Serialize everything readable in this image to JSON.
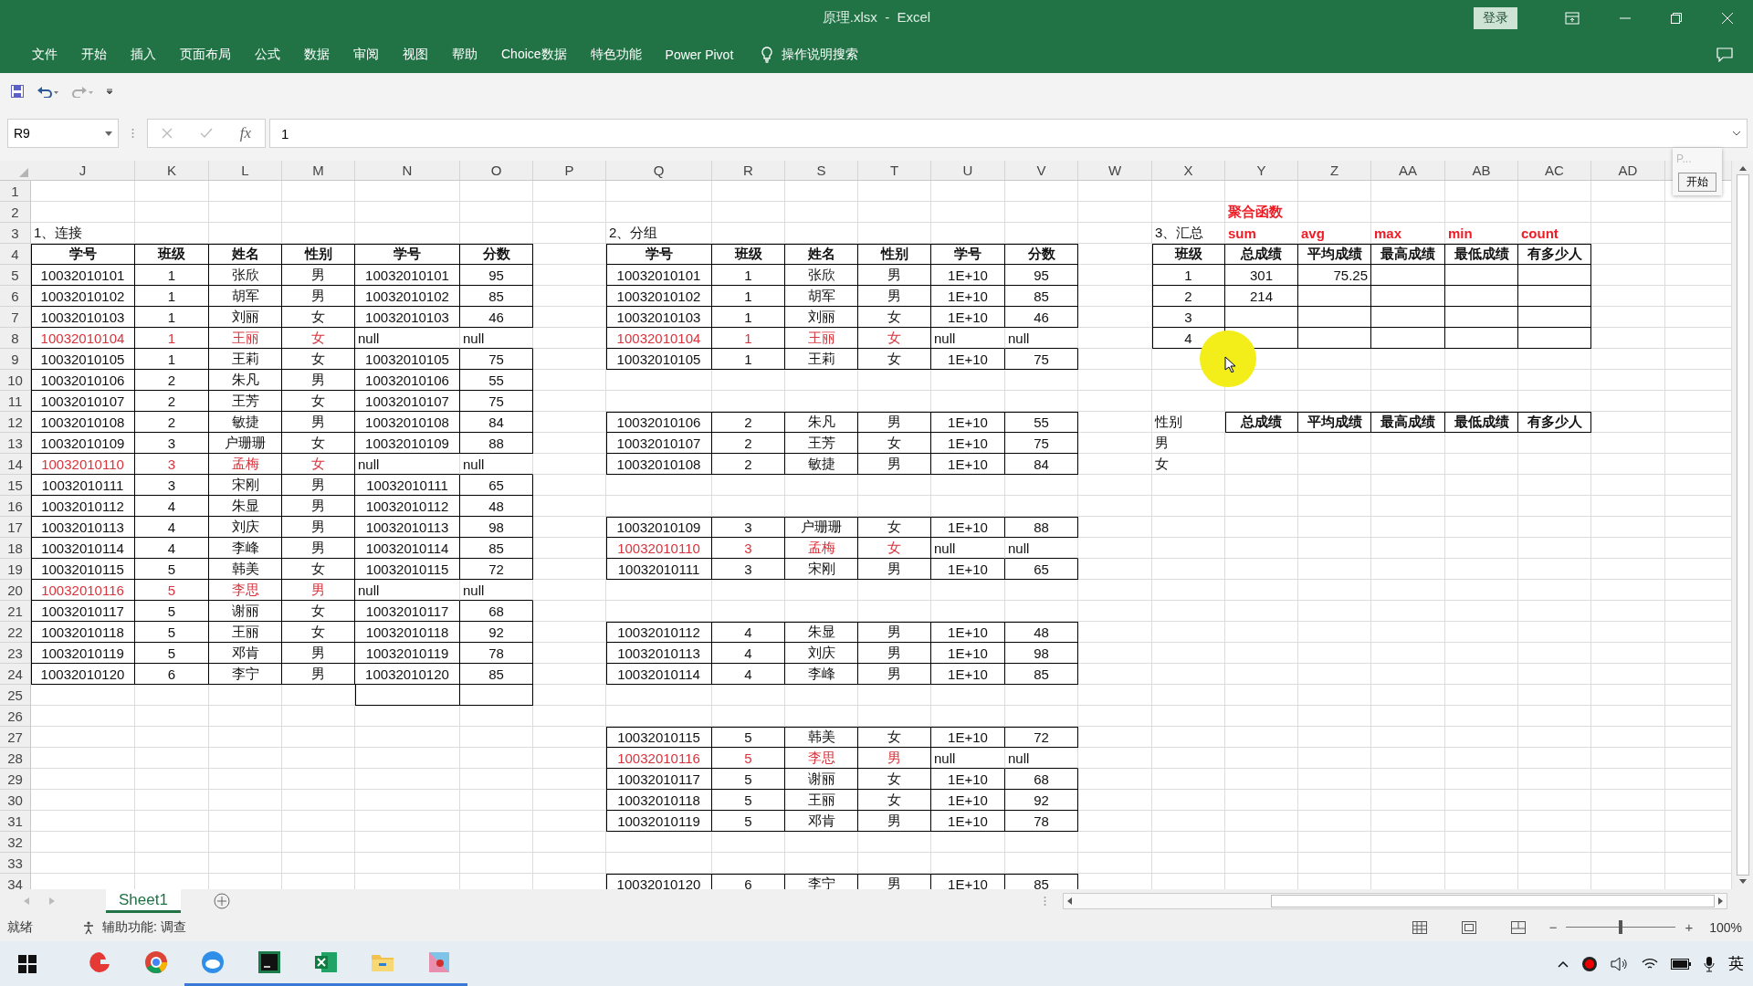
{
  "title_bar": {
    "title": "原理.xlsx  -  Excel",
    "login": "登录"
  },
  "ribbon_tabs": [
    "文件",
    "开始",
    "插入",
    "页面布局",
    "公式",
    "数据",
    "审阅",
    "视图",
    "帮助",
    "Choice数据",
    "特色功能",
    "Power Pivot"
  ],
  "tell_me": "操作说明搜索",
  "formula_bar": {
    "name_box": "R9",
    "fx": "fx",
    "value": "1"
  },
  "columns": [
    "J",
    "K",
    "L",
    "M",
    "N",
    "O",
    "P",
    "Q",
    "R",
    "S",
    "T",
    "U",
    "V",
    "W",
    "X",
    "Y",
    "Z",
    "AA",
    "AB",
    "AC",
    "AD"
  ],
  "rows": [
    "1",
    "2",
    "3",
    "4",
    "5",
    "6",
    "7",
    "8",
    "9",
    "10",
    "11",
    "12",
    "13",
    "14",
    "15",
    "16",
    "17",
    "18",
    "19",
    "20",
    "21",
    "22",
    "23",
    "24",
    "25",
    "26",
    "27",
    "28",
    "29",
    "30",
    "31",
    "32",
    "33",
    "34"
  ],
  "join_table": {
    "title": "1、连接",
    "headers": [
      "学号",
      "班级",
      "姓名",
      "性别",
      "学号",
      "分数"
    ],
    "rows": [
      {
        "cells": [
          "10032010101",
          "1",
          "张欣",
          "男",
          "10032010101",
          "95"
        ],
        "missing": false
      },
      {
        "cells": [
          "10032010102",
          "1",
          "胡军",
          "男",
          "10032010102",
          "85"
        ],
        "missing": false
      },
      {
        "cells": [
          "10032010103",
          "1",
          "刘丽",
          "女",
          "10032010103",
          "46"
        ],
        "missing": false
      },
      {
        "cells": [
          "10032010104",
          "1",
          "王丽",
          "女",
          "null",
          "null"
        ],
        "missing": true
      },
      {
        "cells": [
          "10032010105",
          "1",
          "王莉",
          "女",
          "10032010105",
          "75"
        ],
        "missing": false
      },
      {
        "cells": [
          "10032010106",
          "2",
          "朱凡",
          "男",
          "10032010106",
          "55"
        ],
        "missing": false
      },
      {
        "cells": [
          "10032010107",
          "2",
          "王芳",
          "女",
          "10032010107",
          "75"
        ],
        "missing": false
      },
      {
        "cells": [
          "10032010108",
          "2",
          "敏捷",
          "男",
          "10032010108",
          "84"
        ],
        "missing": false
      },
      {
        "cells": [
          "10032010109",
          "3",
          "户珊珊",
          "女",
          "10032010109",
          "88"
        ],
        "missing": false
      },
      {
        "cells": [
          "10032010110",
          "3",
          "孟梅",
          "女",
          "null",
          "null"
        ],
        "missing": true
      },
      {
        "cells": [
          "10032010111",
          "3",
          "宋刚",
          "男",
          "10032010111",
          "65"
        ],
        "missing": false
      },
      {
        "cells": [
          "10032010112",
          "4",
          "朱显",
          "男",
          "10032010112",
          "48"
        ],
        "missing": false
      },
      {
        "cells": [
          "10032010113",
          "4",
          "刘庆",
          "男",
          "10032010113",
          "98"
        ],
        "missing": false
      },
      {
        "cells": [
          "10032010114",
          "4",
          "李峰",
          "男",
          "10032010114",
          "85"
        ],
        "missing": false
      },
      {
        "cells": [
          "10032010115",
          "5",
          "韩美",
          "女",
          "10032010115",
          "72"
        ],
        "missing": false
      },
      {
        "cells": [
          "10032010116",
          "5",
          "李思",
          "男",
          "null",
          "null"
        ],
        "missing": true
      },
      {
        "cells": [
          "10032010117",
          "5",
          "谢丽",
          "女",
          "10032010117",
          "68"
        ],
        "missing": false
      },
      {
        "cells": [
          "10032010118",
          "5",
          "王丽",
          "女",
          "10032010118",
          "92"
        ],
        "missing": false
      },
      {
        "cells": [
          "10032010119",
          "5",
          "邓肯",
          "男",
          "10032010119",
          "78"
        ],
        "missing": false
      },
      {
        "cells": [
          "10032010120",
          "6",
          "李宁",
          "男",
          "10032010120",
          "85"
        ],
        "missing": false
      }
    ],
    "blank_boxed_row": true
  },
  "group_table": {
    "title": "2、分组",
    "headers": [
      "学号",
      "班级",
      "姓名",
      "性别",
      "学号",
      "分数"
    ],
    "groups": [
      {
        "rows": [
          {
            "cells": [
              "10032010101",
              "1",
              "张欣",
              "男",
              "1E+10",
              "95"
            ],
            "missing": false
          },
          {
            "cells": [
              "10032010102",
              "1",
              "胡军",
              "男",
              "1E+10",
              "85"
            ],
            "missing": false
          },
          {
            "cells": [
              "10032010103",
              "1",
              "刘丽",
              "女",
              "1E+10",
              "46"
            ],
            "missing": false
          },
          {
            "cells": [
              "10032010104",
              "1",
              "王丽",
              "女",
              "null",
              "null"
            ],
            "missing": true
          },
          {
            "cells": [
              "10032010105",
              "1",
              "王莉",
              "女",
              "1E+10",
              "75"
            ],
            "missing": false
          }
        ]
      },
      {
        "rows": [
          {
            "cells": [
              "10032010106",
              "2",
              "朱凡",
              "男",
              "1E+10",
              "55"
            ],
            "missing": false
          },
          {
            "cells": [
              "10032010107",
              "2",
              "王芳",
              "女",
              "1E+10",
              "75"
            ],
            "missing": false
          },
          {
            "cells": [
              "10032010108",
              "2",
              "敏捷",
              "男",
              "1E+10",
              "84"
            ],
            "missing": false
          }
        ]
      },
      {
        "rows": [
          {
            "cells": [
              "10032010109",
              "3",
              "户珊珊",
              "女",
              "1E+10",
              "88"
            ],
            "missing": false
          },
          {
            "cells": [
              "10032010110",
              "3",
              "孟梅",
              "女",
              "null",
              "null"
            ],
            "missing": true
          },
          {
            "cells": [
              "10032010111",
              "3",
              "宋刚",
              "男",
              "1E+10",
              "65"
            ],
            "missing": false
          }
        ]
      },
      {
        "rows": [
          {
            "cells": [
              "10032010112",
              "4",
              "朱显",
              "男",
              "1E+10",
              "48"
            ],
            "missing": false
          },
          {
            "cells": [
              "10032010113",
              "4",
              "刘庆",
              "男",
              "1E+10",
              "98"
            ],
            "missing": false
          },
          {
            "cells": [
              "10032010114",
              "4",
              "李峰",
              "男",
              "1E+10",
              "85"
            ],
            "missing": false
          }
        ]
      },
      {
        "rows": [
          {
            "cells": [
              "10032010115",
              "5",
              "韩美",
              "女",
              "1E+10",
              "72"
            ],
            "missing": false
          },
          {
            "cells": [
              "10032010116",
              "5",
              "李思",
              "男",
              "null",
              "null"
            ],
            "missing": true
          },
          {
            "cells": [
              "10032010117",
              "5",
              "谢丽",
              "女",
              "1E+10",
              "68"
            ],
            "missing": false
          },
          {
            "cells": [
              "10032010118",
              "5",
              "王丽",
              "女",
              "1E+10",
              "92"
            ],
            "missing": false
          },
          {
            "cells": [
              "10032010119",
              "5",
              "邓肯",
              "男",
              "1E+10",
              "78"
            ],
            "missing": false
          }
        ]
      },
      {
        "rows": [
          {
            "cells": [
              "10032010120",
              "6",
              "李宁",
              "男",
              "1E+10",
              "85"
            ],
            "missing": false
          }
        ]
      }
    ]
  },
  "summary": {
    "caption": "聚合函数",
    "title": "3、汇总",
    "functions": [
      "sum",
      "avg",
      "max",
      "min",
      "count"
    ],
    "class_headers": [
      "班级",
      "总成绩",
      "平均成绩",
      "最高成绩",
      "最低成绩",
      "有多少人"
    ],
    "class_rows": [
      {
        "cells": [
          "1",
          "301",
          "75.25"
        ]
      },
      {
        "cells": [
          "2",
          "214"
        ]
      },
      {
        "cells": [
          "3"
        ]
      },
      {
        "cells": [
          "4"
        ]
      }
    ],
    "gender_label": "性别",
    "gender_headers": [
      "总成绩",
      "平均成绩",
      "最高成绩",
      "最低成绩",
      "有多少人"
    ],
    "genders": [
      "男",
      "女"
    ]
  },
  "floating_toolbar": {
    "label": "P...",
    "button": "开始"
  },
  "sheet_tabs": [
    {
      "label": "Sheet1",
      "selected": true
    }
  ],
  "status_bar": {
    "status": "就绪",
    "accessibility": "辅助功能: 调查",
    "zoom": "100%",
    "zoom_out": "−",
    "zoom_in": "+",
    "zoom_slider": {
      "level": 0.5
    }
  },
  "taskbar": {
    "input_method": "英"
  }
}
